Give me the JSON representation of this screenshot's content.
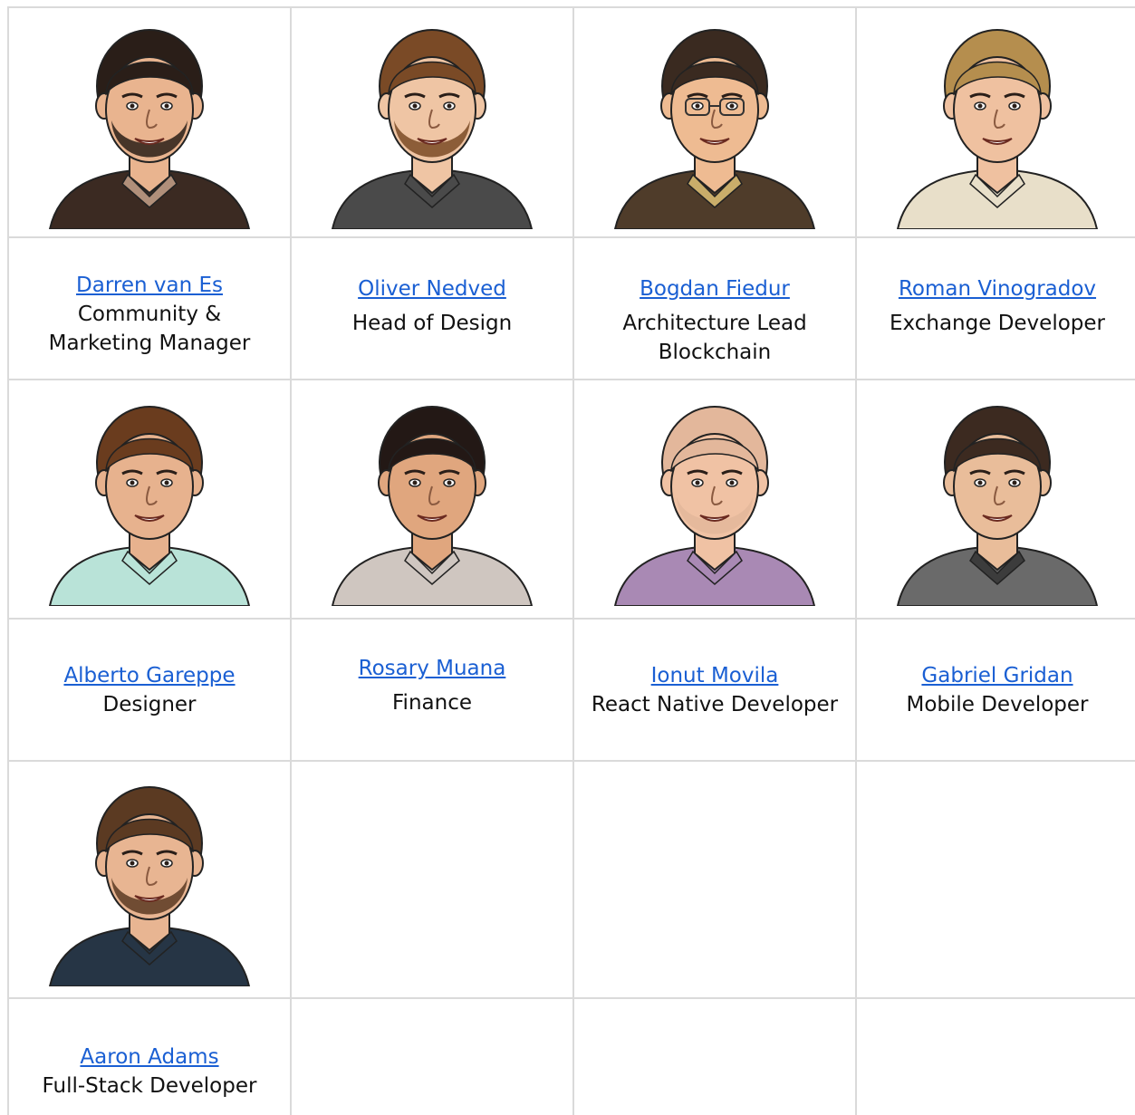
{
  "members": [
    {
      "name": "Darren van Es",
      "role_lines": [
        "Community &",
        "Marketing Manager"
      ],
      "hair": "#2a1e18",
      "skin": "#e9b48f",
      "shirt": "#3b2a22",
      "collar": "#b08f7a",
      "beard": true,
      "glasses": false
    },
    {
      "name": "Oliver Nedved",
      "role_lines": [
        "Head of Design"
      ],
      "hair": "#7a4a26",
      "skin": "#efc5a4",
      "shirt": "#4a4a4a",
      "collar": "#4a4a4a",
      "beard": true,
      "glasses": false
    },
    {
      "name": "Bogdan Fiedur",
      "role_lines": [
        "Architecture Lead",
        "Blockchain"
      ],
      "hair": "#3a2a20",
      "skin": "#eebb92",
      "shirt": "#4f3c2a",
      "collar": "#c9ad6a",
      "beard": false,
      "glasses": true
    },
    {
      "name": "Roman Vinogradov",
      "role_lines": [
        "Exchange Developer"
      ],
      "hair": "#b58e4e",
      "skin": "#efc1a0",
      "shirt": "#e8dfc9",
      "collar": "#e8dfc9",
      "beard": false,
      "glasses": false
    },
    {
      "name": "Alberto Gareppe",
      "role_lines": [
        "Designer"
      ],
      "hair": "#6a3c1e",
      "skin": "#e7b28e",
      "shirt": "#b9e3d8",
      "collar": "#b9e3d8",
      "beard": false,
      "glasses": false
    },
    {
      "name": "Rosary Muana",
      "role_lines": [
        "Finance"
      ],
      "hair": "#231815",
      "skin": "#e0a67e",
      "shirt": "#cfc6c0",
      "collar": "#cfc6c0",
      "beard": false,
      "glasses": false
    },
    {
      "name": "Ionut Movila",
      "role_lines": [
        "React Native Developer"
      ],
      "hair": "#e3b79b",
      "skin": "#f0c2a4",
      "shirt": "#a989b4",
      "collar": "#a989b4",
      "beard": true,
      "glasses": false
    },
    {
      "name": "Gabriel Gridan",
      "role_lines": [
        "Mobile Developer"
      ],
      "hair": "#3c2a20",
      "skin": "#e9bd9a",
      "shirt": "#6a6a6a",
      "collar": "#3c3c3c",
      "beard": false,
      "glasses": false
    },
    {
      "name": "Aaron Adams",
      "role_lines": [
        "Full-Stack Developer"
      ],
      "hair": "#5b3a22",
      "skin": "#e8b592",
      "shirt": "#263545",
      "collar": "#263545",
      "beard": true,
      "glasses": false
    }
  ],
  "colors": {
    "link": "#1a5fd3",
    "border": "#dadada",
    "text": "#111111"
  }
}
